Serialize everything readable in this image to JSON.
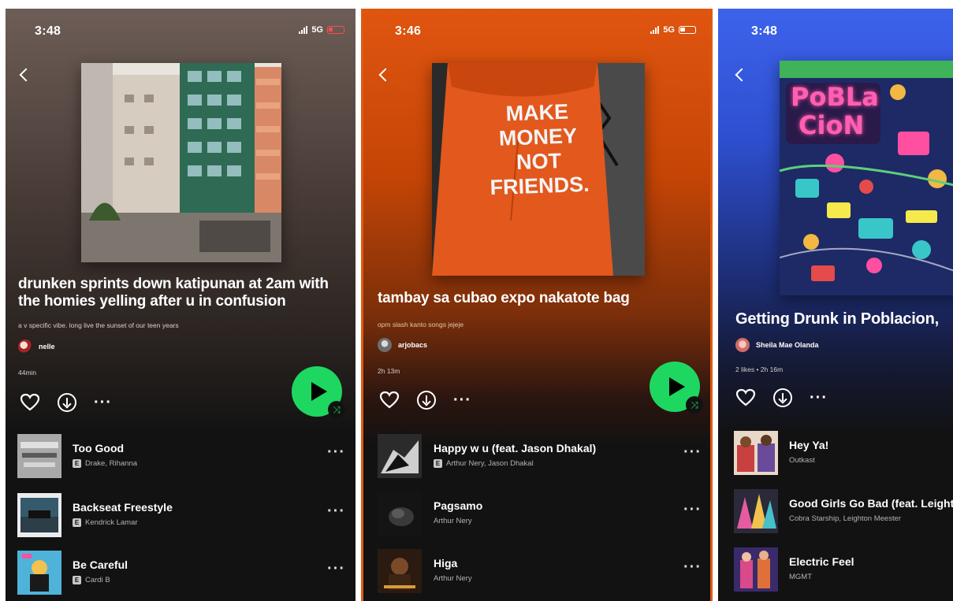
{
  "screens": [
    {
      "status_time": "3:48",
      "status_network": "5G",
      "playlist_title": "drunken sprints down katipunan at 2am with the homies yelling after u in confusion",
      "description": "a v specific vibe. long live the sunset of our teen years",
      "owner": "nelle",
      "meta": "44min",
      "tracks": [
        {
          "title": "Too Good",
          "artist": "Drake, Rihanna",
          "explicit": "E"
        },
        {
          "title": "Backseat Freestyle",
          "artist": "Kendrick Lamar",
          "explicit": "E"
        },
        {
          "title": "Be Careful",
          "artist": "Cardi B",
          "explicit": "E"
        }
      ]
    },
    {
      "status_time": "3:46",
      "status_network": "5G",
      "playlist_title": "tambay sa cubao expo nakatote bag",
      "description": "opm slash kanto songs jejeje",
      "owner": "arjobacs",
      "meta": "2h 13m",
      "cover_text": [
        "MAKE",
        "MONEY",
        "NOT",
        "FRIENDS."
      ],
      "tracks": [
        {
          "title": "Happy w u (feat. Jason Dhakal)",
          "artist": "Arthur Nery, Jason Dhakal",
          "explicit": "E"
        },
        {
          "title": "Pagsamo",
          "artist": "Arthur Nery"
        },
        {
          "title": "Higa",
          "artist": "Arthur Nery"
        }
      ]
    },
    {
      "status_time": "3:48",
      "playlist_title": "Getting Drunk in Poblacion,",
      "owner": "Sheila Mae Olanda",
      "meta": "2 likes • 2h 16m",
      "cover_text": [
        "PoBLa",
        "CioN"
      ],
      "tracks": [
        {
          "title": "Hey Ya!",
          "artist": "Outkast"
        },
        {
          "title": "Good Girls Go Bad (feat. Leight",
          "artist": "Cobra Starship, Leighton Meester"
        },
        {
          "title": "Electric Feel",
          "artist": "MGMT"
        }
      ]
    }
  ],
  "icons": {
    "back": "chevron-left-icon",
    "like": "heart-icon",
    "download": "download-icon",
    "more": "more-horizontal-icon",
    "play": "play-icon",
    "shuffle": "shuffle-icon",
    "shuffle_glyph": "⤨",
    "more_glyph": "···"
  },
  "colors": {
    "spotify_green": "#1ed760",
    "screen1_bg": "#6d5d56",
    "screen2_bg": "#e05510",
    "screen3_bg": "#3d63ec",
    "background": "#121212"
  }
}
